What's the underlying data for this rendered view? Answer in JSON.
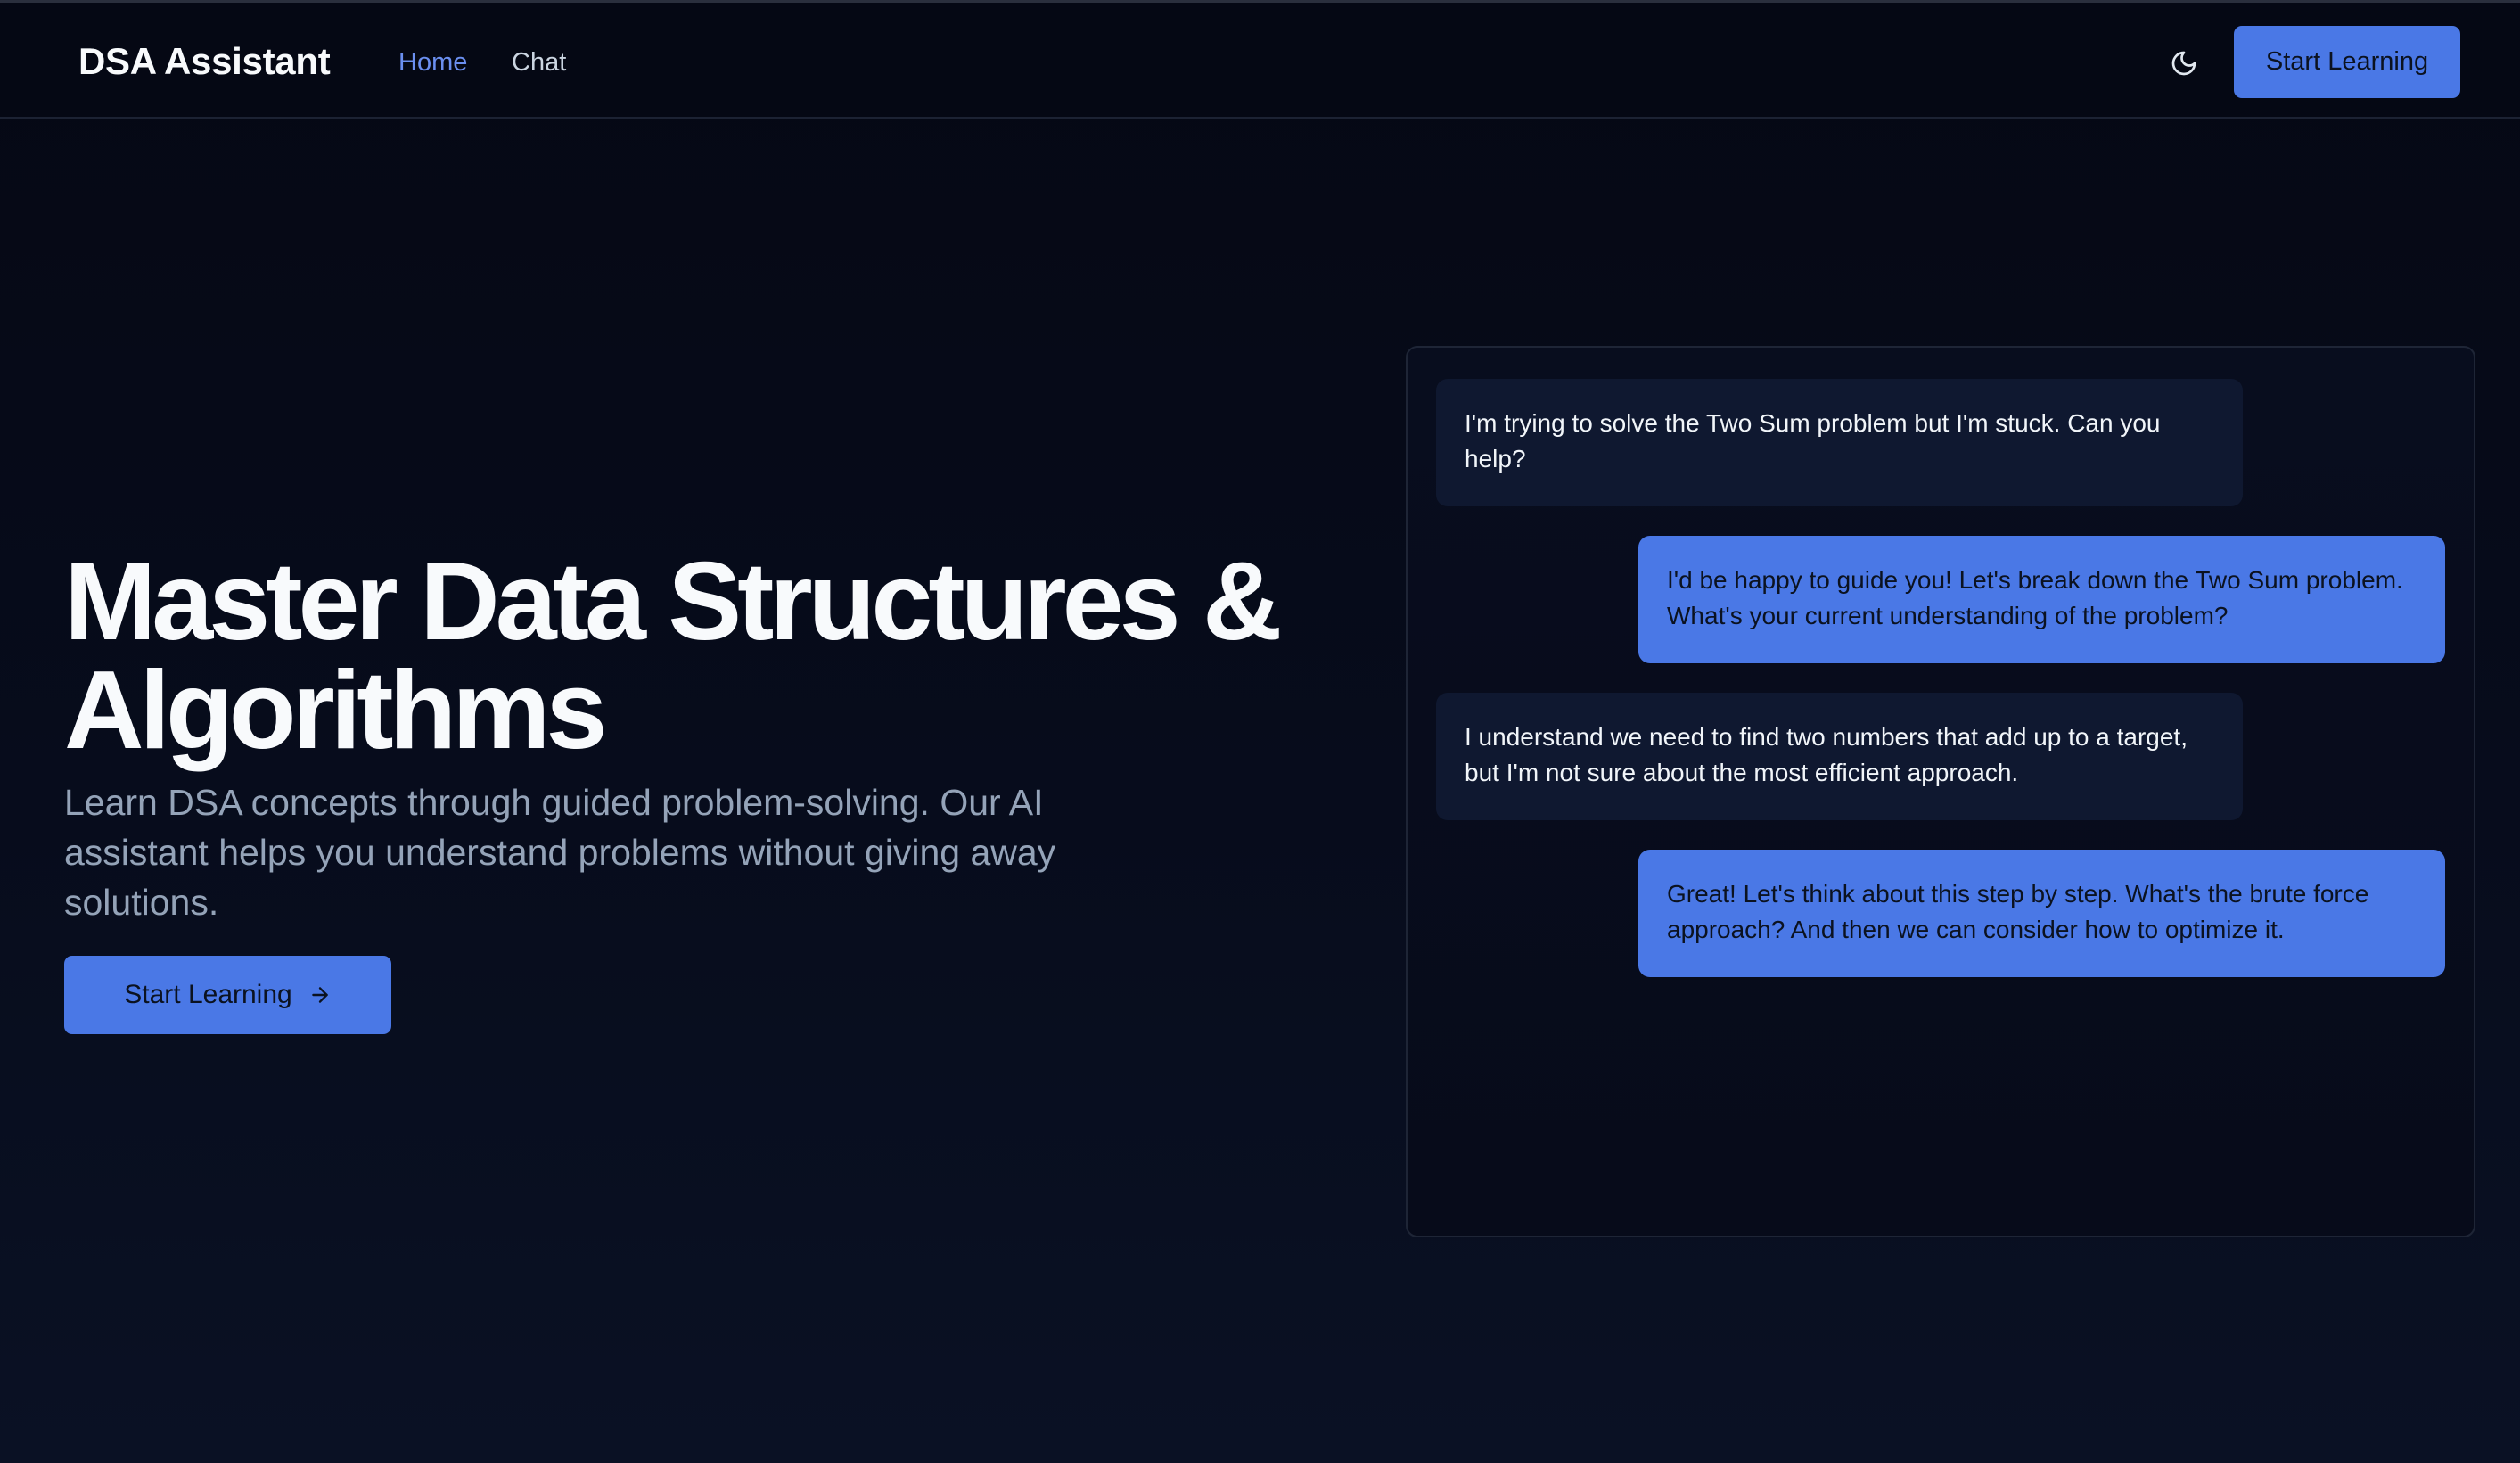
{
  "header": {
    "brand": "DSA Assistant",
    "nav": [
      {
        "label": "Home",
        "active": true
      },
      {
        "label": "Chat",
        "active": false
      }
    ],
    "theme_toggle_icon": "moon-icon",
    "cta_label": "Start Learning"
  },
  "hero": {
    "title_line1": "Master Data Structures &",
    "title_line2": "Algorithms",
    "subtitle": "Learn DSA concepts through guided problem-solving. Our AI assistant helps you understand problems without giving away solutions.",
    "cta_label": "Start Learning",
    "cta_icon": "arrow-right-icon"
  },
  "chat_preview": {
    "messages": [
      {
        "role": "user",
        "text": "I'm trying to solve the Two Sum problem but I'm stuck. Can you help?"
      },
      {
        "role": "assistant",
        "text": "I'd be happy to guide you! Let's break down the Two Sum problem. What's your current understanding of the problem?"
      },
      {
        "role": "user",
        "text": "I understand we need to find two numbers that add up to a target, but I'm not sure about the most efficient approach."
      },
      {
        "role": "assistant",
        "text": "Great! Let's think about this step by step. What's the brute force approach? And then we can consider how to optimize it."
      }
    ]
  },
  "colors": {
    "background": "#060a18",
    "accent": "#4a78e6",
    "nav_active": "#6b8ff0",
    "user_bubble": "#0f1830",
    "muted_text": "#94a3b8"
  }
}
